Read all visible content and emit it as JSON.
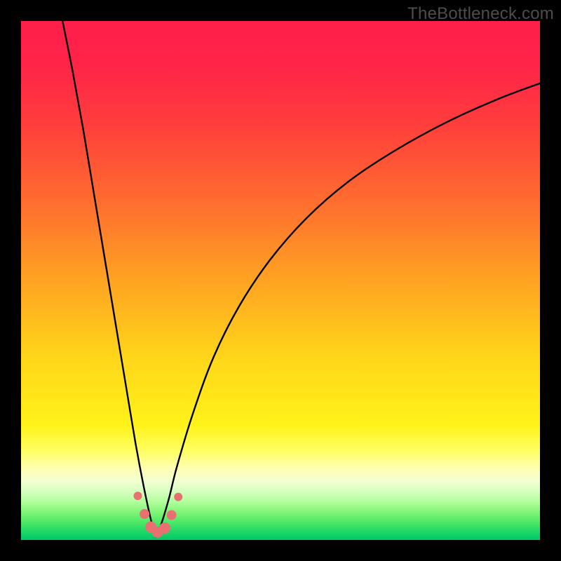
{
  "watermark": "TheBottleneck.com",
  "colors": {
    "gradient_stops": [
      {
        "offset": 0,
        "color": "#ff1f4b"
      },
      {
        "offset": 0.08,
        "color": "#ff2348"
      },
      {
        "offset": 0.2,
        "color": "#ff3e3c"
      },
      {
        "offset": 0.35,
        "color": "#ff6d2f"
      },
      {
        "offset": 0.5,
        "color": "#ffa322"
      },
      {
        "offset": 0.65,
        "color": "#ffd61a"
      },
      {
        "offset": 0.78,
        "color": "#fff31a"
      },
      {
        "offset": 0.83,
        "color": "#ffff66"
      },
      {
        "offset": 0.86,
        "color": "#ffffb0"
      },
      {
        "offset": 0.885,
        "color": "#f4ffd0"
      },
      {
        "offset": 0.905,
        "color": "#d8ffc0"
      },
      {
        "offset": 0.925,
        "color": "#b4ff9e"
      },
      {
        "offset": 0.945,
        "color": "#84f57a"
      },
      {
        "offset": 0.965,
        "color": "#4fe968"
      },
      {
        "offset": 0.985,
        "color": "#1bd765"
      },
      {
        "offset": 1.0,
        "color": "#00c76a"
      }
    ],
    "curve": "#000000",
    "marker_fill": "#e97070",
    "marker_stroke": "#c94f4f"
  },
  "chart_data": {
    "type": "line",
    "title": "",
    "xlabel": "",
    "ylabel": "",
    "xlim": [
      0,
      100
    ],
    "ylim": [
      0,
      100
    ],
    "x_optimum": 26,
    "series": [
      {
        "name": "left-branch",
        "x": [
          8,
          10,
          12,
          14,
          16,
          18,
          20,
          22,
          23.5,
          25,
          26
        ],
        "y": [
          100,
          90,
          79,
          67,
          55,
          43,
          31,
          19,
          11,
          4,
          0.5
        ]
      },
      {
        "name": "right-branch",
        "x": [
          26,
          27,
          28.5,
          30,
          33,
          37,
          42,
          48,
          55,
          63,
          72,
          82,
          92,
          100
        ],
        "y": [
          0.5,
          3,
          8,
          14,
          24,
          35,
          45,
          54,
          62,
          69,
          75,
          80.5,
          85,
          88
        ]
      }
    ],
    "markers": {
      "name": "highlight-cluster",
      "points": [
        {
          "x": 22.5,
          "y": 8.5,
          "r": 6
        },
        {
          "x": 23.8,
          "y": 5.0,
          "r": 7
        },
        {
          "x": 25.0,
          "y": 2.5,
          "r": 8
        },
        {
          "x": 26.3,
          "y": 1.5,
          "r": 8
        },
        {
          "x": 27.7,
          "y": 2.3,
          "r": 8
        },
        {
          "x": 29.0,
          "y": 4.8,
          "r": 7
        },
        {
          "x": 30.3,
          "y": 8.3,
          "r": 6
        }
      ]
    }
  }
}
